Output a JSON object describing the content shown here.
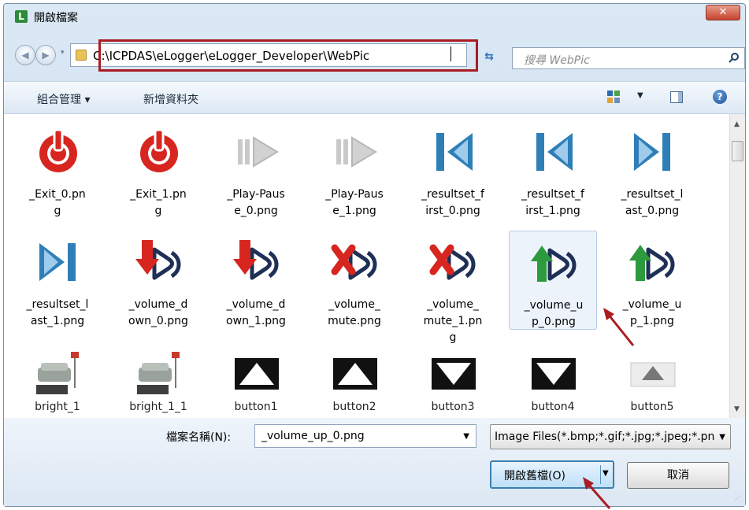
{
  "window": {
    "title": "開啟檔案",
    "close_label": "✕",
    "app_icon_label": "L"
  },
  "nav": {
    "back_glyph": "◀",
    "forward_glyph": "▶",
    "address": "C:\\ICPDAS\\eLogger\\eLogger_Developer\\WebPic",
    "search_placeholder": "搜尋 WebPic"
  },
  "toolbar": {
    "organize_label": "組合管理 ▾",
    "new_folder_label": "新增資料夾",
    "help_label": "?"
  },
  "files": [
    {
      "name": "_Exit_0.png",
      "kind": "power"
    },
    {
      "name": "_Exit_1.png",
      "kind": "power"
    },
    {
      "name": "_Play-Pause_0.png",
      "kind": "play"
    },
    {
      "name": "_Play-Pause_1.png",
      "kind": "play"
    },
    {
      "name": "_resultset_first_0.png",
      "kind": "first"
    },
    {
      "name": "_resultset_first_1.png",
      "kind": "first"
    },
    {
      "name": "_resultset_last_0.png",
      "kind": "last"
    },
    {
      "name": "_resultset_last_1.png",
      "kind": "last"
    },
    {
      "name": "_volume_down_0.png",
      "kind": "voldown"
    },
    {
      "name": "_volume_down_1.png",
      "kind": "voldown"
    },
    {
      "name": "_volume_mute.png",
      "kind": "mute"
    },
    {
      "name": "_volume_mute_1.png",
      "kind": "mute"
    },
    {
      "name": "_volume_up_0.png",
      "kind": "volup",
      "selected": true
    },
    {
      "name": "_volume_up_1.png",
      "kind": "volup"
    },
    {
      "name": "bright_1",
      "kind": "lamp"
    },
    {
      "name": "bright_1_1",
      "kind": "lamp"
    },
    {
      "name": "button1",
      "kind": "tri-up"
    },
    {
      "name": "button2",
      "kind": "tri-up"
    },
    {
      "name": "button3",
      "kind": "tri-down"
    },
    {
      "name": "button4",
      "kind": "tri-down"
    },
    {
      "name": "button5",
      "kind": "tri-up-gray"
    }
  ],
  "bottom": {
    "filename_label": "檔案名稱(N):",
    "filename_value": "_volume_up_0.png",
    "filter_value": "Image Files(*.bmp;*.gif;*.jpg;*.jpeg;*.png)",
    "open_label": "開啟舊檔(O)",
    "cancel_label": "取消"
  },
  "colors": {
    "highlight_box": "#a91d22",
    "accent_blue": "#3c7fb1"
  }
}
